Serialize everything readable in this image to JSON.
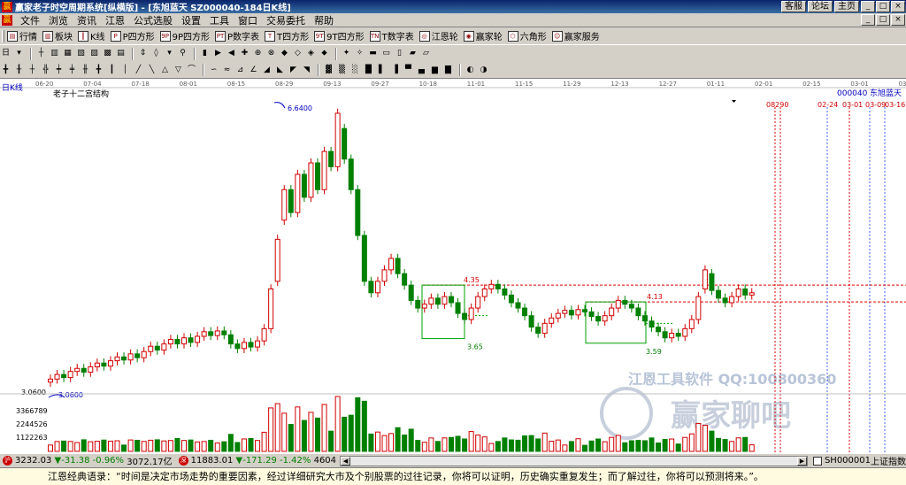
{
  "window": {
    "title": "赢家老子时空周期系统[纵横版] - [东旭蓝天   SZ000040-184日K线]",
    "links": [
      "客服",
      "论坛",
      "主页"
    ],
    "controls": [
      "_",
      "□",
      "×"
    ]
  },
  "menu": {
    "items": [
      "文件",
      "浏览",
      "资讯",
      "江恩",
      "公式选股",
      "设置",
      "工具",
      "窗口",
      "交易委托",
      "帮助"
    ]
  },
  "toolbar": {
    "buttons": [
      {
        "label": "行情",
        "icon": "quote-icon",
        "ico": "▤"
      },
      {
        "label": "板块",
        "icon": "sector-icon",
        "ico": "▥"
      },
      {
        "label": "K线",
        "icon": "kline-icon",
        "ico": "┃"
      },
      {
        "label": "P四方形",
        "icon": "p-square-icon",
        "ico": "P"
      },
      {
        "label": "9P四方形",
        "icon": "9p-square-icon",
        "ico": "9P"
      },
      {
        "label": "P数字表",
        "icon": "p-table-icon",
        "ico": "PT"
      },
      {
        "label": "T四方形",
        "icon": "t-square-icon",
        "ico": "T"
      },
      {
        "label": "9T四方形",
        "icon": "9t-square-icon",
        "ico": "9T"
      },
      {
        "label": "T数字表",
        "icon": "t-table-icon",
        "ico": "TN"
      },
      {
        "label": "江恩轮",
        "icon": "gann-wheel-icon",
        "ico": "◎"
      },
      {
        "label": "赢家轮",
        "icon": "winner-wheel-icon",
        "ico": "◉"
      },
      {
        "label": "六角形",
        "icon": "hexagon-icon",
        "ico": "⬡"
      },
      {
        "label": "赢家服务",
        "icon": "service-icon",
        "ico": "☺"
      }
    ]
  },
  "chart_header": {
    "period": "日K线",
    "study": "老子十二宫结构",
    "code": "000040",
    "name": "东旭蓝天"
  },
  "watermark": {
    "software": "江恩工具软件  QQ:100800360",
    "brand": "赢家聊吧"
  },
  "colors": {
    "up": "#d00000",
    "down": "#008000",
    "ma_line": "#b06070",
    "box": "#00a000",
    "level": "#e00000",
    "timeline_red": "#e00000",
    "timeline_blue": "#4060ff"
  },
  "chart_data": {
    "type": "candlestick",
    "x_ticks": [
      "06-20",
      "07-04",
      "07-18",
      "08-01",
      "08-15",
      "08-29",
      "09-13",
      "09-27",
      "10-18",
      "11-01",
      "11-15",
      "11-29",
      "12-13",
      "12-27",
      "01-11",
      "02-01",
      "02-15",
      "03-01",
      "03-15"
    ],
    "price_axis_labels": [
      "3.0600"
    ],
    "annotations": [
      {
        "label": "6.6400",
        "kind": "high"
      },
      {
        "label": "3.0600",
        "kind": "low"
      },
      {
        "label": "4.35",
        "kind": "level"
      },
      {
        "label": "4.13",
        "kind": "level"
      },
      {
        "label": "3.65",
        "kind": "box-low"
      },
      {
        "label": "3.59",
        "kind": "box-low"
      }
    ],
    "future_dates": [
      "08290",
      "02-24",
      "03-01",
      "03-09",
      "03-16"
    ],
    "volume_axis_labels": [
      "3366789",
      "2244526",
      "1122263"
    ],
    "series": [
      {
        "o": 3.08,
        "c": 3.12
      },
      {
        "o": 3.12,
        "c": 3.18
      },
      {
        "o": 3.18,
        "c": 3.14
      },
      {
        "o": 3.14,
        "c": 3.22
      },
      {
        "o": 3.22,
        "c": 3.26
      },
      {
        "o": 3.26,
        "c": 3.21
      },
      {
        "o": 3.21,
        "c": 3.28
      },
      {
        "o": 3.28,
        "c": 3.33
      },
      {
        "o": 3.33,
        "c": 3.29
      },
      {
        "o": 3.29,
        "c": 3.36
      },
      {
        "o": 3.36,
        "c": 3.41
      },
      {
        "o": 3.41,
        "c": 3.37
      },
      {
        "o": 3.37,
        "c": 3.45
      },
      {
        "o": 3.45,
        "c": 3.4
      },
      {
        "o": 3.4,
        "c": 3.48
      },
      {
        "o": 3.48,
        "c": 3.55
      },
      {
        "o": 3.55,
        "c": 3.5
      },
      {
        "o": 3.5,
        "c": 3.58
      },
      {
        "o": 3.58,
        "c": 3.64
      },
      {
        "o": 3.64,
        "c": 3.58
      },
      {
        "o": 3.58,
        "c": 3.66
      },
      {
        "o": 3.66,
        "c": 3.6
      },
      {
        "o": 3.6,
        "c": 3.68
      },
      {
        "o": 3.68,
        "c": 3.74
      },
      {
        "o": 3.74,
        "c": 3.69
      },
      {
        "o": 3.69,
        "c": 3.75
      },
      {
        "o": 3.75,
        "c": 3.7
      },
      {
        "o": 3.7,
        "c": 3.58
      },
      {
        "o": 3.58,
        "c": 3.52
      },
      {
        "o": 3.52,
        "c": 3.6
      },
      {
        "o": 3.6,
        "c": 3.54
      },
      {
        "o": 3.54,
        "c": 3.62
      },
      {
        "o": 3.62,
        "c": 3.78
      },
      {
        "o": 3.78,
        "c": 4.3
      },
      {
        "o": 4.4,
        "c": 4.95
      },
      {
        "o": 5.2,
        "c": 5.6
      },
      {
        "o": 5.6,
        "c": 5.3
      },
      {
        "o": 5.3,
        "c": 5.8
      },
      {
        "o": 5.8,
        "c": 5.5
      },
      {
        "o": 5.5,
        "c": 5.95
      },
      {
        "o": 5.95,
        "c": 5.6
      },
      {
        "o": 5.6,
        "c": 6.1
      },
      {
        "o": 6.1,
        "c": 5.9
      },
      {
        "o": 5.9,
        "c": 6.6
      },
      {
        "o": 6.4,
        "c": 6.0
      },
      {
        "o": 6.0,
        "c": 5.6
      },
      {
        "o": 5.6,
        "c": 5.0
      },
      {
        "o": 5.0,
        "c": 4.4
      },
      {
        "o": 4.4,
        "c": 4.25
      },
      {
        "o": 4.25,
        "c": 4.4
      },
      {
        "o": 4.4,
        "c": 4.55
      },
      {
        "o": 4.55,
        "c": 4.7
      },
      {
        "o": 4.7,
        "c": 4.5
      },
      {
        "o": 4.5,
        "c": 4.35
      },
      {
        "o": 4.35,
        "c": 4.15
      },
      {
        "o": 4.15,
        "c": 4.05
      },
      {
        "o": 4.05,
        "c": 4.1
      },
      {
        "o": 4.1,
        "c": 4.18
      },
      {
        "o": 4.18,
        "c": 4.1
      },
      {
        "o": 4.1,
        "c": 4.2
      },
      {
        "o": 4.2,
        "c": 4.12
      },
      {
        "o": 4.12,
        "c": 3.98
      },
      {
        "o": 3.98,
        "c": 3.9
      },
      {
        "o": 3.9,
        "c": 4.05
      },
      {
        "o": 4.05,
        "c": 4.2
      },
      {
        "o": 4.2,
        "c": 4.3
      },
      {
        "o": 4.3,
        "c": 4.36
      },
      {
        "o": 4.36,
        "c": 4.3
      },
      {
        "o": 4.3,
        "c": 4.22
      },
      {
        "o": 4.22,
        "c": 4.12
      },
      {
        "o": 4.12,
        "c": 4.05
      },
      {
        "o": 4.05,
        "c": 3.95
      },
      {
        "o": 3.95,
        "c": 3.8
      },
      {
        "o": 3.8,
        "c": 3.72
      },
      {
        "o": 3.72,
        "c": 3.85
      },
      {
        "o": 3.85,
        "c": 3.92
      },
      {
        "o": 3.92,
        "c": 3.98
      },
      {
        "o": 3.98,
        "c": 4.02
      },
      {
        "o": 4.02,
        "c": 3.96
      },
      {
        "o": 3.96,
        "c": 4.03
      },
      {
        "o": 4.03,
        "c": 4.0
      },
      {
        "o": 4.0,
        "c": 3.94
      },
      {
        "o": 3.94,
        "c": 3.88
      },
      {
        "o": 3.88,
        "c": 3.95
      },
      {
        "o": 3.95,
        "c": 4.05
      },
      {
        "o": 4.05,
        "c": 4.15
      },
      {
        "o": 4.15,
        "c": 4.1
      },
      {
        "o": 4.1,
        "c": 4.05
      },
      {
        "o": 4.05,
        "c": 3.95
      },
      {
        "o": 3.95,
        "c": 3.88
      },
      {
        "o": 3.88,
        "c": 3.8
      },
      {
        "o": 3.8,
        "c": 3.74
      },
      {
        "o": 3.74,
        "c": 3.66
      },
      {
        "o": 3.66,
        "c": 3.72
      },
      {
        "o": 3.72,
        "c": 3.68
      },
      {
        "o": 3.68,
        "c": 3.78
      },
      {
        "o": 3.78,
        "c": 3.9
      },
      {
        "o": 3.9,
        "c": 4.2
      },
      {
        "o": 4.3,
        "c": 4.55
      },
      {
        "o": 4.5,
        "c": 4.28
      },
      {
        "o": 4.28,
        "c": 4.18
      },
      {
        "o": 4.18,
        "c": 4.12
      },
      {
        "o": 4.12,
        "c": 4.2
      },
      {
        "o": 4.2,
        "c": 4.3
      },
      {
        "o": 4.3,
        "c": 4.22
      },
      {
        "o": 4.22,
        "c": 4.25
      }
    ]
  },
  "status_bar": {
    "sh_value": "3232.03",
    "sh_change": "▼-31.38",
    "sh_pct": "-0.96%",
    "sh_amount": "3072.17亿",
    "sz_value": "11883.01",
    "sz_change": "▼-171.29",
    "sz_pct": "-1.42%",
    "sz_amount": "4604",
    "code": "SH000001",
    "code_name": "上证指数"
  },
  "quote": {
    "text": "江恩经典语录：“时间是决定市场走势的重要因素，经过详细研究大市及个别股票的过往记录，你将可以证明，历史确实重复发生；而了解过往，你将可以预测将来。”。"
  }
}
